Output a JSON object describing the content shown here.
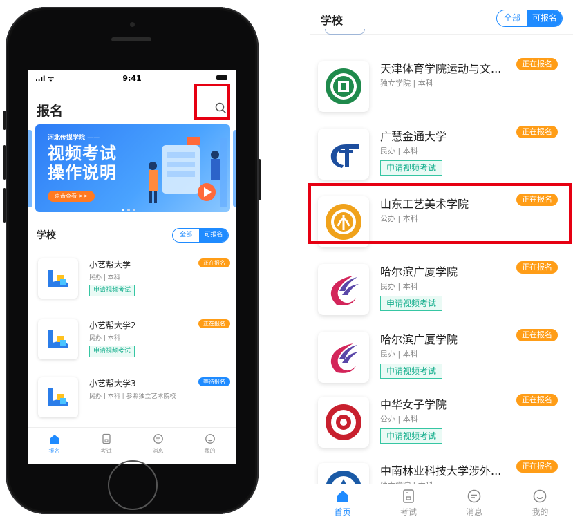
{
  "phone": {
    "status_bar": {
      "time": "9:41",
      "signal": "..ıl ᯤ"
    },
    "page_title": "报名",
    "banner": {
      "tag": "河北传媒学院 ——",
      "headline_1": "视频考试",
      "headline_2": "操作说明",
      "button": "点击查看 >>"
    },
    "section_title": "学校",
    "toggle": {
      "all": "全部",
      "available": "可报名"
    },
    "schools": [
      {
        "name": "小艺帮大学",
        "meta": "民办 | 本科",
        "apply": "申请视频考试",
        "badge": "正在报名",
        "badge_color": "#ff9d17"
      },
      {
        "name": "小艺帮大学2",
        "meta": "民办 | 本科",
        "apply": "申请视频考试",
        "badge": "正在报名",
        "badge_color": "#ff9d17"
      },
      {
        "name": "小艺帮大学3",
        "meta": "民办 | 本科 | 参照独立艺术院校",
        "badge": "等待报名",
        "badge_color": "#1f8bff"
      }
    ],
    "tabs": [
      {
        "label": "报名",
        "icon": "home-icon"
      },
      {
        "label": "考试",
        "icon": "exam-icon"
      },
      {
        "label": "消息",
        "icon": "message-icon"
      },
      {
        "label": "我的",
        "icon": "profile-icon"
      }
    ]
  },
  "panel": {
    "section_title": "学校",
    "toggle": {
      "all": "全部",
      "available": "可报名"
    },
    "schools": [
      {
        "name": "天津体育学院运动与文...",
        "meta": "独立学院 | 本科",
        "badge": "正在报名",
        "logo": "tianjin-sport-logo"
      },
      {
        "name": "广慧金通大学",
        "meta": "民办 | 本科",
        "apply": "申请视频考试",
        "badge": "正在报名",
        "logo": "guanghui-logo"
      },
      {
        "name": "山东工艺美术学院",
        "meta": "公办 | 本科",
        "badge": "正在报名",
        "logo": "shandong-art-logo"
      },
      {
        "name": "哈尔滨广厦学院",
        "meta": "民办 | 本科",
        "apply": "申请视频考试",
        "badge": "正在报名",
        "logo": "harbin-guangsha-logo"
      },
      {
        "name": "哈尔滨广厦学院",
        "meta": "民办 | 本科",
        "apply": "申请视频考试",
        "badge": "正在报名",
        "logo": "harbin-guangsha-logo"
      },
      {
        "name": "中华女子学院",
        "meta": "公办 | 本科",
        "apply": "申请视频考试",
        "badge": "正在报名",
        "logo": "china-women-logo"
      },
      {
        "name": "中南林业科技大学涉外...",
        "meta": "独立学院 | 本科",
        "badge": "正在报名",
        "logo": "csuft-logo"
      }
    ],
    "tabs": [
      {
        "label": "首页",
        "icon": "home-icon"
      },
      {
        "label": "考试",
        "icon": "exam-icon"
      },
      {
        "label": "消息",
        "icon": "message-icon"
      },
      {
        "label": "我的",
        "icon": "profile-icon"
      }
    ]
  },
  "colors": {
    "accent": "#1f8bff",
    "badge_orange": "#ff9d17",
    "apply_green": "#19b08f",
    "highlight_red": "#e60012"
  }
}
